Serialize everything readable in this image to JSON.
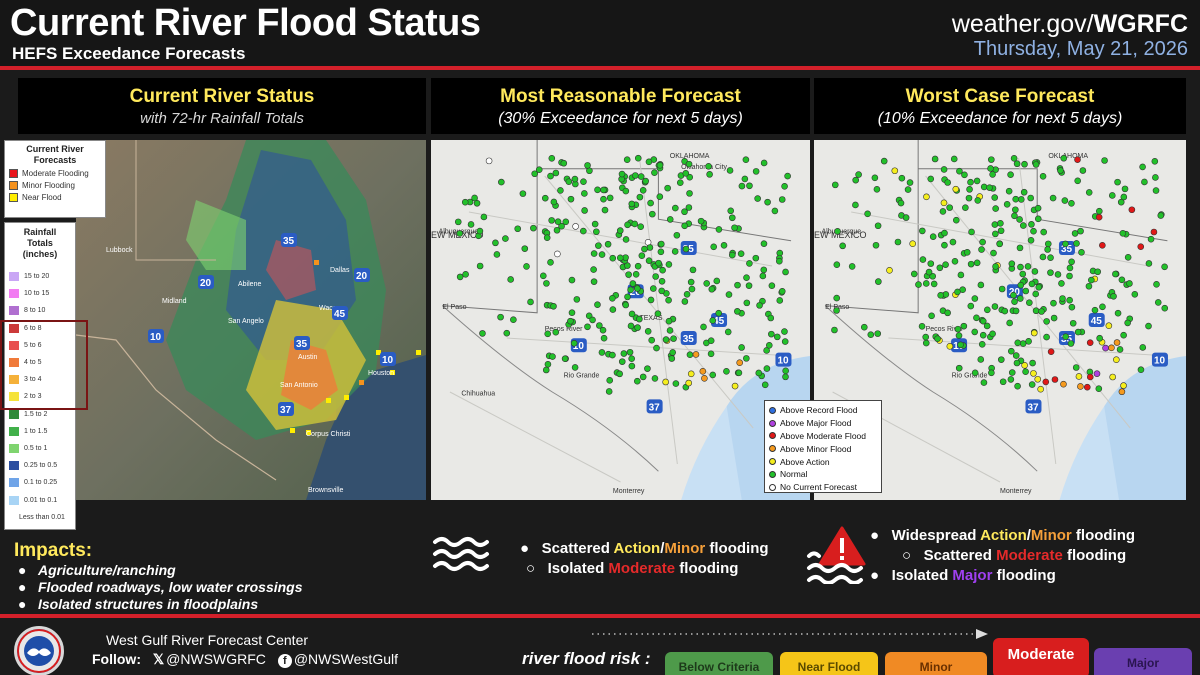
{
  "header": {
    "title": "Current River Flood Status",
    "subtitle": "HEFS Exceedance Forecasts",
    "site_prefix": "weather.gov/",
    "site_bold": "WGRFC",
    "date": "Thursday, May 21, 2026"
  },
  "panels": [
    {
      "title": "Current River Status",
      "subtitle": "with 72-hr Rainfall Totals"
    },
    {
      "title": "Most Reasonable Forecast",
      "subtitle": "(30% Exceedance for next 5 days)"
    },
    {
      "title": "Worst Case Forecast",
      "subtitle": "(10% Exceedance for next 5 days)"
    }
  ],
  "legend_status": {
    "title_1": "Current River",
    "title_2": "Forecasts",
    "items": [
      {
        "label": "Moderate Flooding",
        "color": "#e8141c"
      },
      {
        "label": "Minor Flooding",
        "color": "#f5921e"
      },
      {
        "label": "Near Flood",
        "color": "#ffee00"
      }
    ]
  },
  "legend_rain": {
    "title_1": "Rainfall",
    "title_2": "Totals",
    "title_3": "(inches)",
    "items": [
      {
        "label": "15 to 20",
        "color": "#c9a6f5"
      },
      {
        "label": "10 to 15",
        "color": "#f27cf2"
      },
      {
        "label": "8 to 10",
        "color": "#b06fd0"
      },
      {
        "label": "6 to 8",
        "color": "#cc3a3a"
      },
      {
        "label": "5 to 6",
        "color": "#e85050"
      },
      {
        "label": "4 to 5",
        "color": "#f07a3a"
      },
      {
        "label": "3 to 4",
        "color": "#f5b13a"
      },
      {
        "label": "2 to 3",
        "color": "#f5e33a"
      },
      {
        "label": "1.5 to 2",
        "color": "#2f8a3a"
      },
      {
        "label": "1 to 1.5",
        "color": "#41b04a"
      },
      {
        "label": "0.5 to 1",
        "color": "#7fd46f"
      },
      {
        "label": "0.25 to 0.5",
        "color": "#2c4fa0"
      },
      {
        "label": "0.1 to 0.25",
        "color": "#6fa4e8"
      },
      {
        "label": "0.01 to 0.1",
        "color": "#a8d4f5"
      },
      {
        "label": "Less than 0.01",
        "color": "#ffffff"
      }
    ]
  },
  "map_labels": {
    "left": [
      "Lubbock",
      "Midland",
      "Abilene",
      "San Angelo",
      "Dallas",
      "Waco",
      "Austin",
      "San Antonio",
      "Houston",
      "Corpus Christi",
      "Brownsville"
    ],
    "middle": [
      "Albuquerque",
      "EW MEXICO",
      "El Paso",
      "Chihuahua",
      "Monterrey",
      "OKLAHOMA",
      "Oklahoma City",
      "Pecos River",
      "Rio Grande",
      "TEXAS"
    ],
    "right": [
      "Albuquerque",
      "EW MEXICO",
      "El Paso",
      "Monterrey",
      "OKLAHOMA",
      "Pecos River",
      "Rio Grande"
    ],
    "shields": [
      "35",
      "20",
      "10",
      "45",
      "37",
      "10",
      "35",
      "20",
      "10",
      "45",
      "37",
      "10",
      "35",
      "20",
      "10",
      "45",
      "37",
      "10"
    ]
  },
  "key_legend": [
    {
      "label": "Above Record Flood",
      "color": "#2f6fe0"
    },
    {
      "label": "Above Major Flood",
      "color": "#b040e0"
    },
    {
      "label": "Above Moderate Flood",
      "color": "#e01818"
    },
    {
      "label": "Above Minor Flood",
      "color": "#f59a1e"
    },
    {
      "label": "Above Action",
      "color": "#f5ee1e"
    },
    {
      "label": "Normal",
      "color": "#22c02a"
    },
    {
      "label": "No Current Forecast",
      "color": "#ffffff"
    }
  ],
  "impacts": {
    "title": "Impacts:",
    "items": [
      "Agriculture/ranching",
      "Flooded roadways, low water crossings",
      "Isolated structures in floodplains"
    ]
  },
  "middle_summary": {
    "l1_pre": "Scattered ",
    "l1_action": "Action",
    "l1_slash": "/",
    "l1_minor": "Minor",
    "l1_post": " flooding",
    "l2_pre": "Isolated ",
    "l2_mod": "Moderate",
    "l2_post": " flooding"
  },
  "right_summary": {
    "l1_pre": "Widespread ",
    "l1_action": "Action",
    "l1_slash": "/",
    "l1_minor": "Minor",
    "l1_post": " flooding",
    "l2_pre": "Scattered ",
    "l2_mod": "Moderate",
    "l2_post": " flooding",
    "l3_pre": "Isolated ",
    "l3_major": "Major",
    "l3_post": " flooding"
  },
  "footer": {
    "center_name": "West Gulf River Forecast Center",
    "follow_label": "Follow:",
    "x_icon": "𝕏",
    "x_handle": "@NWSWGRFC",
    "fb_icon": "f",
    "fb_handle": "@NWSWestGulf",
    "risk_label": "river flood risk :",
    "risk_levels": [
      {
        "label": "Below Criteria",
        "color": "#4e9a4a",
        "text_color": "#1d3a1a"
      },
      {
        "label": "Near Flood",
        "color": "#f5c518",
        "text_color": "#5a4a00"
      },
      {
        "label": "Minor",
        "color": "#f08a24",
        "text_color": "#6a3000"
      },
      {
        "label": "Moderate",
        "color": "#d81e1e",
        "text_color": "#ffffff"
      },
      {
        "label": "Major",
        "color": "#6a3fb0",
        "text_color": "#2a1550"
      }
    ]
  }
}
